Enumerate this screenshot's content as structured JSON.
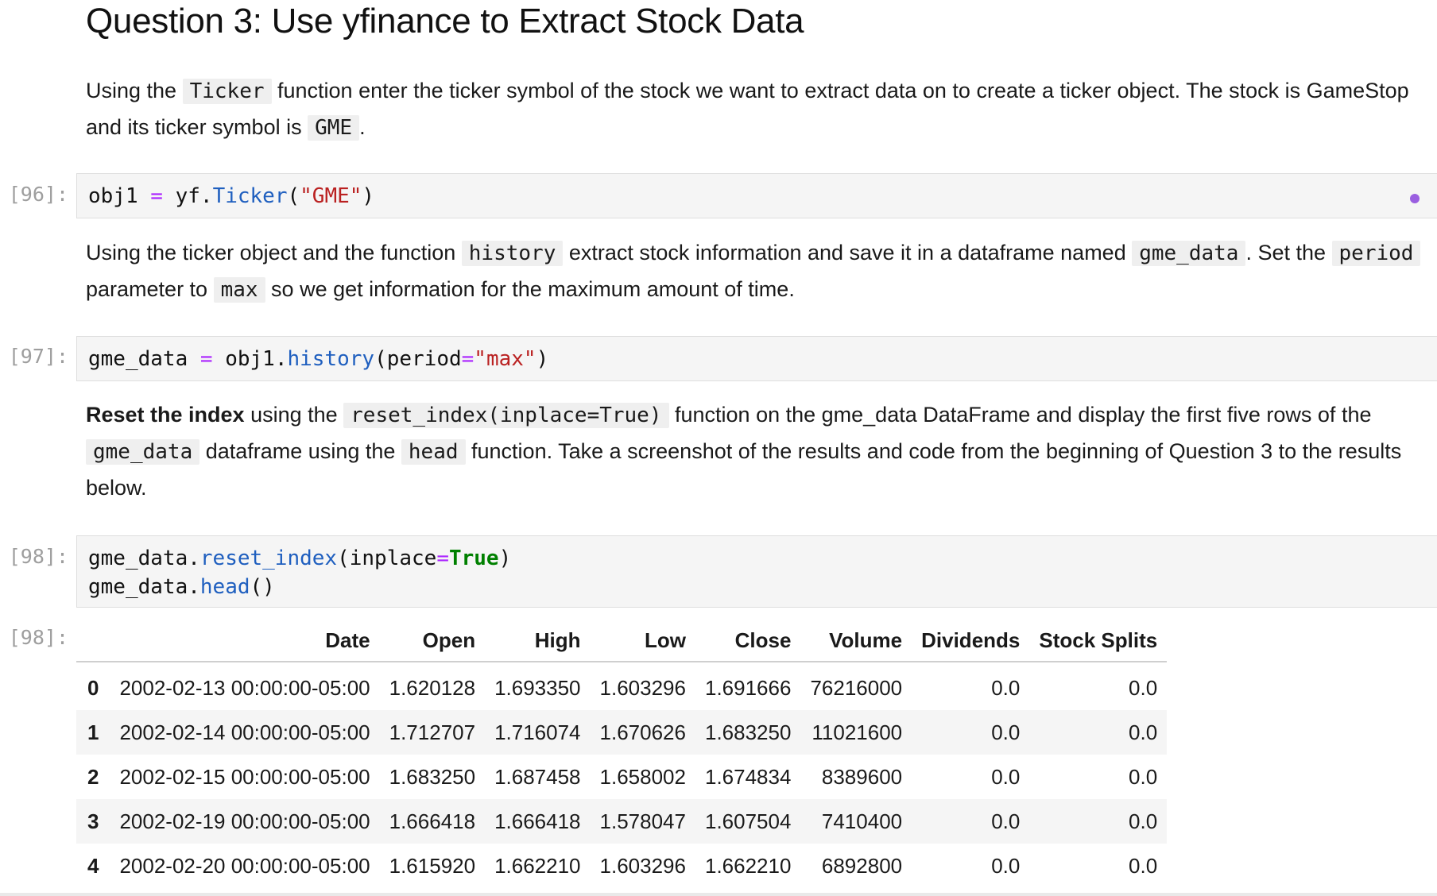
{
  "heading": "Question 3: Use yfinance to Extract Stock Data",
  "para1": {
    "t1": "Using the ",
    "c1": "Ticker",
    "t2": " function enter the ticker symbol of the stock we want to extract data on to create a ticker object. The stock is GameStop and its ticker symbol is ",
    "c2": "GME",
    "t3": "."
  },
  "cell96": {
    "prompt": "[96]:",
    "a": "obj1",
    "op": "=",
    "b": "yf.",
    "fn": "Ticker",
    "p1": "(",
    "str": "\"GME\"",
    "p2": ")"
  },
  "para2": {
    "t1": "Using the ticker object and the function ",
    "c1": "history",
    "t2": " extract stock information and save it in a dataframe named ",
    "c2": "gme_data",
    "t3": ". Set the ",
    "c3": "period",
    "t4": " parameter to ",
    "c4": "max",
    "t5": " so we get information for the maximum amount of time."
  },
  "cell97": {
    "prompt": "[97]:",
    "a": "gme_data",
    "op": "=",
    "b": "obj1.",
    "fn": "history",
    "p1": "(period",
    "op2": "=",
    "str": "\"max\"",
    "p2": ")"
  },
  "para3": {
    "bold": "Reset the index",
    "t1": " using the ",
    "c1": "reset_index(inplace=True)",
    "t2": " function on the gme_data DataFrame and display the first five rows of the ",
    "c2": "gme_data",
    "t3": " dataframe using the ",
    "c3": "head",
    "t4": " function. Take a screenshot of the results and code from the beginning of Question 3 to the results below."
  },
  "cell98": {
    "prompt": "[98]:",
    "l1a": "gme_data.",
    "l1fn": "reset_index",
    "l1b": "(inplace",
    "l1op": "=",
    "l1kw": "True",
    "l1c": ")",
    "l2a": "gme_data.",
    "l2fn": "head",
    "l2b": "()"
  },
  "output98": {
    "prompt": "[98]:",
    "columns": [
      "",
      "Date",
      "Open",
      "High",
      "Low",
      "Close",
      "Volume",
      "Dividends",
      "Stock Splits"
    ],
    "rows": [
      [
        "0",
        "2002-02-13 00:00:00-05:00",
        "1.620128",
        "1.693350",
        "1.603296",
        "1.691666",
        "76216000",
        "0.0",
        "0.0"
      ],
      [
        "1",
        "2002-02-14 00:00:00-05:00",
        "1.712707",
        "1.716074",
        "1.670626",
        "1.683250",
        "11021600",
        "0.0",
        "0.0"
      ],
      [
        "2",
        "2002-02-15 00:00:00-05:00",
        "1.683250",
        "1.687458",
        "1.658002",
        "1.674834",
        "8389600",
        "0.0",
        "0.0"
      ],
      [
        "3",
        "2002-02-19 00:00:00-05:00",
        "1.666418",
        "1.666418",
        "1.578047",
        "1.607504",
        "7410400",
        "0.0",
        "0.0"
      ],
      [
        "4",
        "2002-02-20 00:00:00-05:00",
        "1.615920",
        "1.662210",
        "1.603296",
        "1.662210",
        "6892800",
        "0.0",
        "0.0"
      ]
    ]
  },
  "colors": {
    "operator": "#aa22ff",
    "function": "#1f5fbf",
    "string": "#ba2121",
    "keyword": "#008000",
    "dirty_indicator": "#9a5fe0"
  }
}
